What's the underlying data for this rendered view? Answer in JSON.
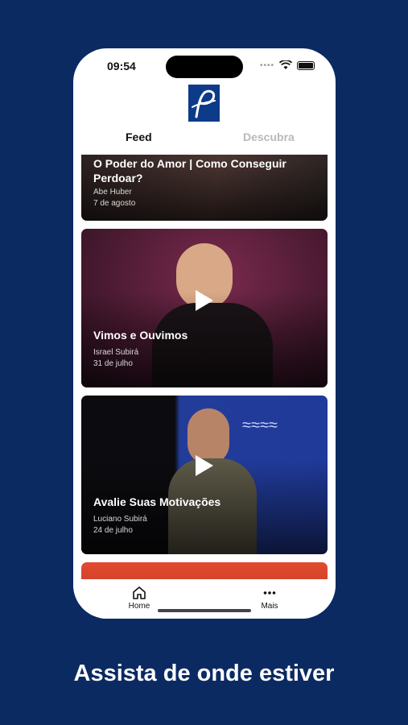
{
  "status_bar": {
    "time": "09:54"
  },
  "header": {
    "logo_letter": "P"
  },
  "tabs": [
    {
      "label": "Feed",
      "active": true
    },
    {
      "label": "Descubra",
      "active": false
    }
  ],
  "feed": {
    "items": [
      {
        "title": "O Poder do Amor | Como Conseguir Perdoar?",
        "author": "Abe Huber",
        "date": "7 de agosto",
        "color": "#3a2b2a"
      },
      {
        "title": "Vimos e Ouvimos",
        "author": "Israel Subirá",
        "date": "31 de julho",
        "color": "#5a1f3d"
      },
      {
        "title": "Avalie Suas Motivações",
        "author": "Luciano Subirá",
        "date": "24 de julho",
        "color": "#1a1e3a"
      }
    ]
  },
  "tabbar": {
    "home": "Home",
    "more": "Mais"
  },
  "caption": "Assista de onde estiver",
  "colors": {
    "background": "#0b2a62",
    "brand": "#0d3b8a"
  }
}
